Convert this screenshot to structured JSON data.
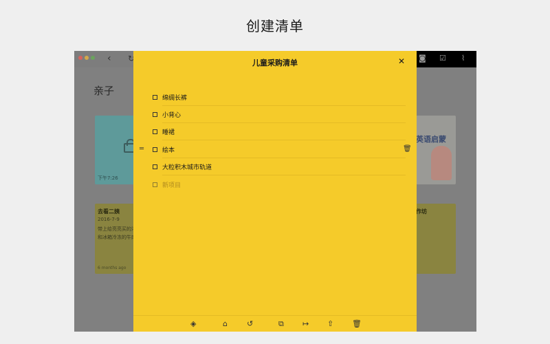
{
  "header": {
    "title": "创建清单"
  },
  "window": {
    "nav": {
      "back": "‹",
      "refresh": "↻"
    },
    "toolbar_right_icons": [
      "camera-icon",
      "checkbox-icon",
      "paperclip-icon"
    ],
    "section_title": "亲子",
    "cards": {
      "locked": {
        "time": "下午7:26"
      },
      "note": {
        "title": "去看二姨",
        "date": "2016-7-9",
        "body_lines": [
          "带上给亮亮买的洋",
          "和冰箱冷冻的牛肉"
        ],
        "age": "6 months ago"
      },
      "book": {
        "text": "英语启蒙"
      },
      "workshop": {
        "title": "作坊"
      }
    }
  },
  "checklist": {
    "title": "儿童采购清单",
    "close": "✕",
    "items": [
      {
        "label": "绵绸长裤"
      },
      {
        "label": "小背心"
      },
      {
        "label": "睡裙"
      },
      {
        "label": "绘本"
      },
      {
        "label": "大粒积木城市轨道"
      }
    ],
    "new_item_placeholder": "新项目",
    "footer_icons": [
      "paint-bucket-icon",
      "lock-icon",
      "history-icon",
      "duplicate-icon",
      "move-icon",
      "share-icon",
      "trash-icon"
    ]
  }
}
